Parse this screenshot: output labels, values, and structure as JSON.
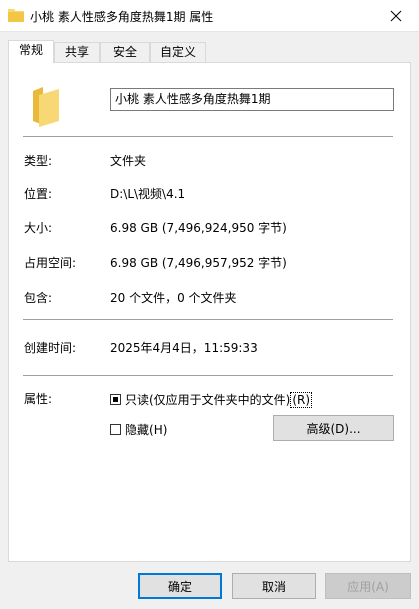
{
  "window": {
    "title": "小桃 素人性感多角度热舞1期 属性"
  },
  "tabs": [
    {
      "label": "常规",
      "active": true
    },
    {
      "label": "共享",
      "active": false
    },
    {
      "label": "安全",
      "active": false
    },
    {
      "label": "自定义",
      "active": false
    }
  ],
  "general": {
    "name_value": "小桃 素人性感多角度热舞1期",
    "type_label": "类型:",
    "type_value": "文件夹",
    "location_label": "位置:",
    "location_value": "D:\\L\\视频\\4.1",
    "size_label": "大小:",
    "size_value": "6.98 GB (7,496,924,950 字节)",
    "size_on_disk_label": "占用空间:",
    "size_on_disk_value": "6.98 GB (7,496,957,952 字节)",
    "contains_label": "包含:",
    "contains_value": "20 个文件，0 个文件夹",
    "created_label": "创建时间:",
    "created_value": "2025年4月4日，11:59:33",
    "attributes_label": "属性:",
    "readonly_label": "只读(仅应用于文件夹中的文件)",
    "readonly_key": "(R)",
    "readonly_state": "indeterminate",
    "hidden_label": "隐藏",
    "hidden_key": "(H)",
    "hidden_state": "unchecked",
    "advanced_button": "高级(D)..."
  },
  "footer": {
    "ok": "确定",
    "cancel": "取消",
    "apply": "应用(A)"
  },
  "colors": {
    "folder_yellow": "#f8d775",
    "focus_blue": "#0078d7"
  },
  "icons": {
    "title_icon": "folder-icon",
    "close_icon": "close-icon",
    "big_icon": "folder-icon"
  }
}
